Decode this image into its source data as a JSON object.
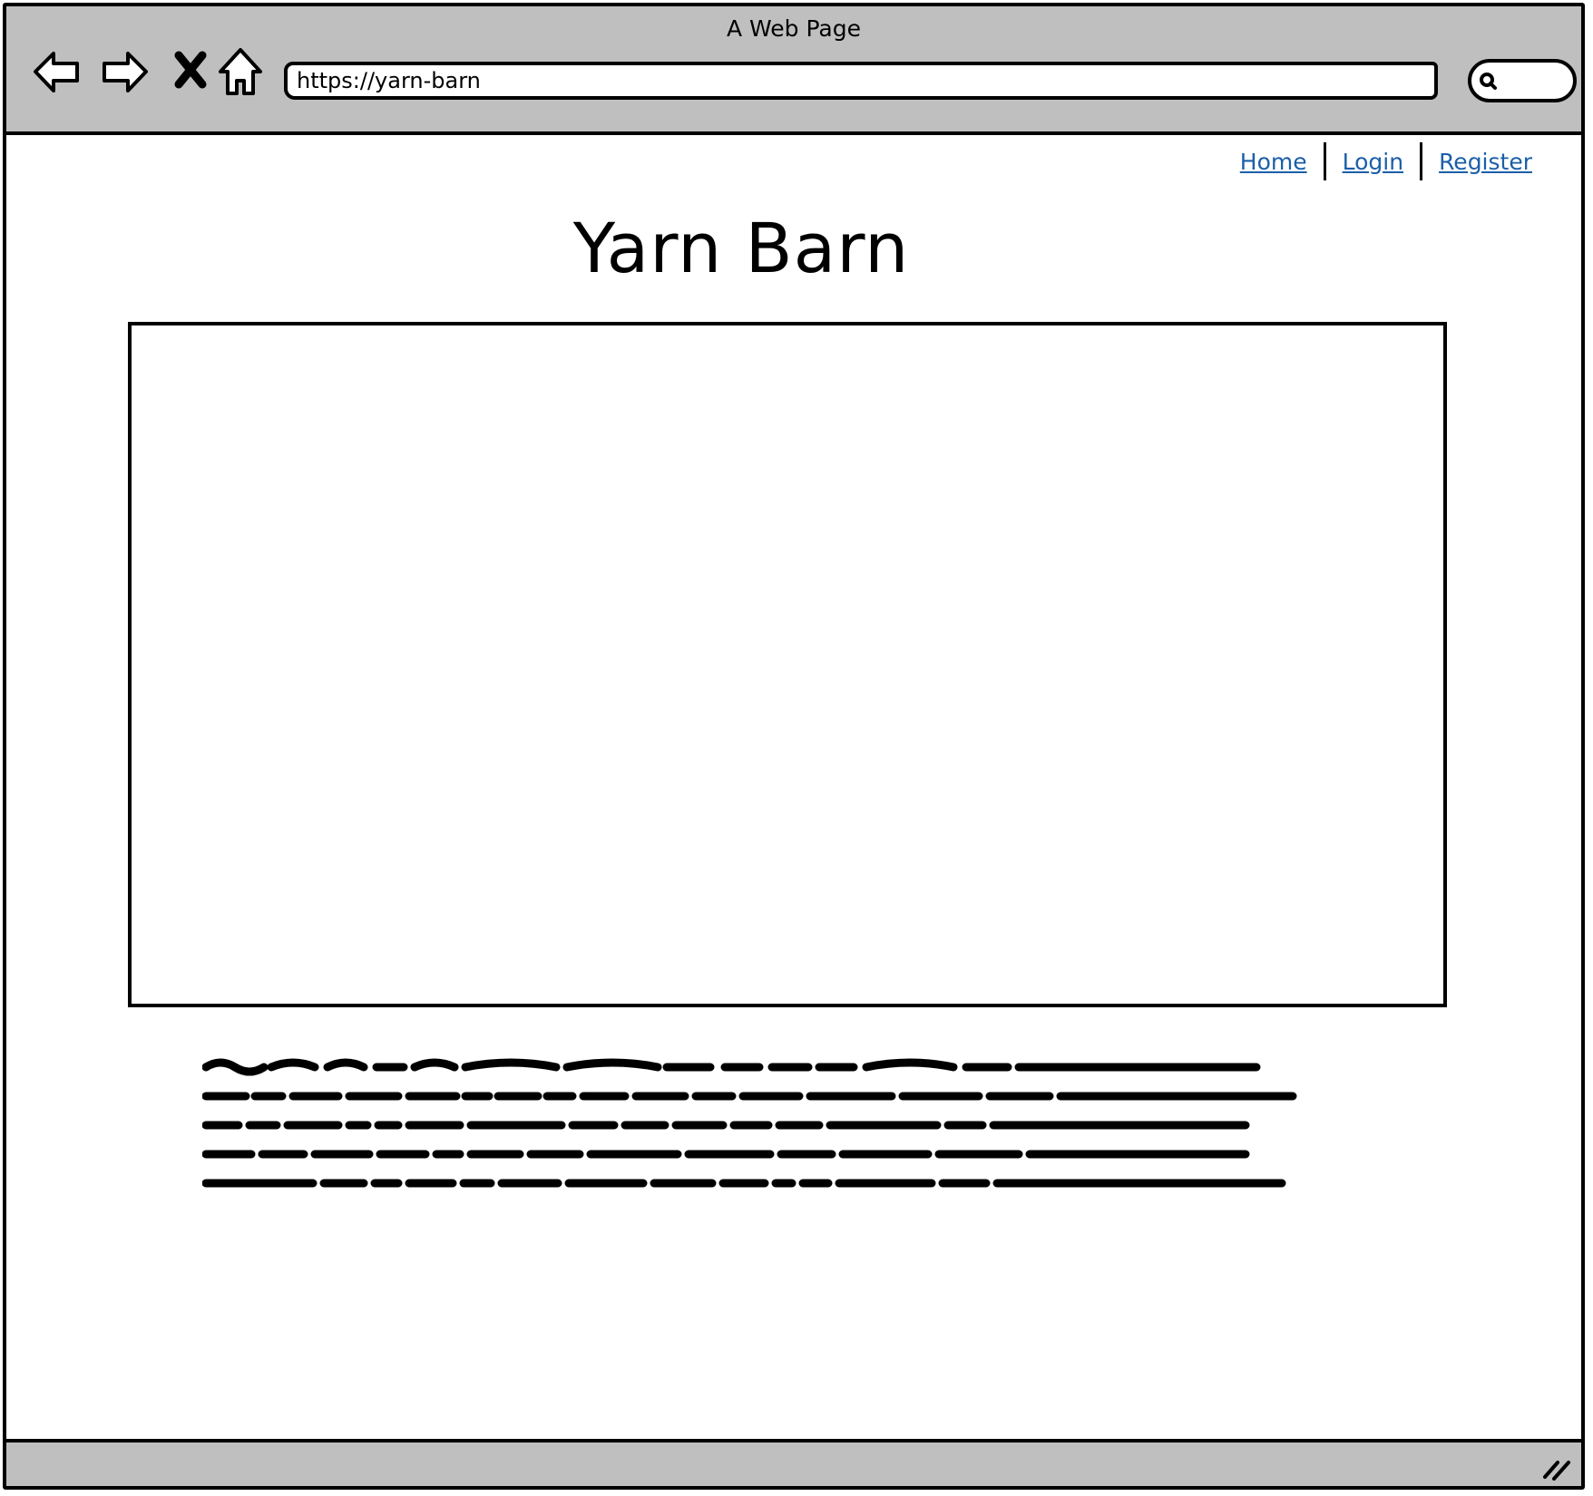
{
  "window": {
    "title": "A Web Page"
  },
  "toolbar": {
    "icons": [
      "back-arrow-icon",
      "forward-arrow-icon",
      "close-x-icon",
      "home-icon"
    ],
    "url": "https://yarn-barn",
    "search_icon": "search-icon"
  },
  "nav": {
    "links": [
      {
        "label": "Home"
      },
      {
        "label": "Login"
      },
      {
        "label": "Register"
      }
    ]
  },
  "page": {
    "title": "Yarn Barn"
  },
  "colors": {
    "chrome": "#bfbfbf",
    "link": "#1b5fa9",
    "border": "#000000"
  }
}
